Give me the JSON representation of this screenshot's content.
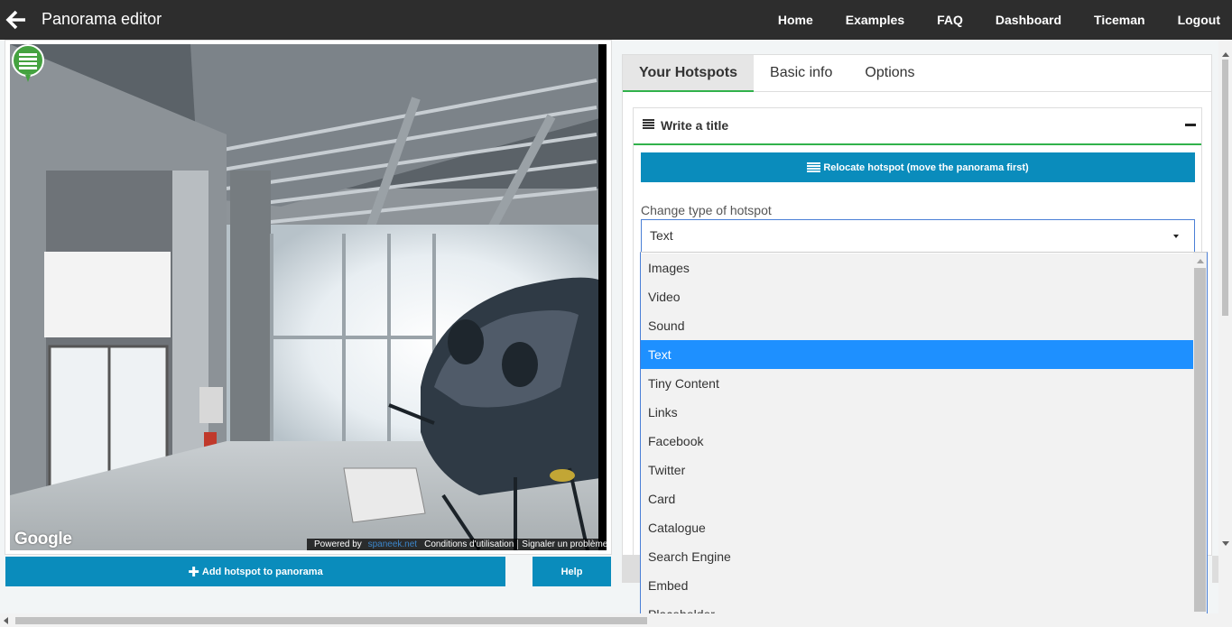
{
  "header": {
    "title": "Panorama editor",
    "nav": [
      "Home",
      "Examples",
      "FAQ",
      "Dashboard",
      "Ticeman",
      "Logout"
    ]
  },
  "panorama": {
    "google_logo": "Google",
    "footer": {
      "powered_by": "Powered by",
      "brand": "spaneek.net",
      "conditions": "Conditions d'utilisation",
      "report": "Signaler un problème"
    }
  },
  "buttons": {
    "add_hotspot": "Add hotspot to panorama",
    "help": "Help"
  },
  "tabs": [
    {
      "label": "Your Hotspots",
      "active": true
    },
    {
      "label": "Basic info",
      "active": false
    },
    {
      "label": "Options",
      "active": false
    }
  ],
  "hotspot": {
    "title": "Write a title",
    "relocate_label": "Relocate hotspot (move the panorama first)",
    "type_label": "Change type of hotspot",
    "selected_type": "Text",
    "options": [
      "Images",
      "Video",
      "Sound",
      "Text",
      "Tiny Content",
      "Links",
      "Facebook",
      "Twitter",
      "Card",
      "Catalogue",
      "Search Engine",
      "Embed",
      "Placeholder"
    ]
  },
  "colors": {
    "accent_blue": "#0a8cbc",
    "tab_green": "#31b24b",
    "selected_option": "#1e90ff",
    "topbar": "#2d2d2d"
  }
}
